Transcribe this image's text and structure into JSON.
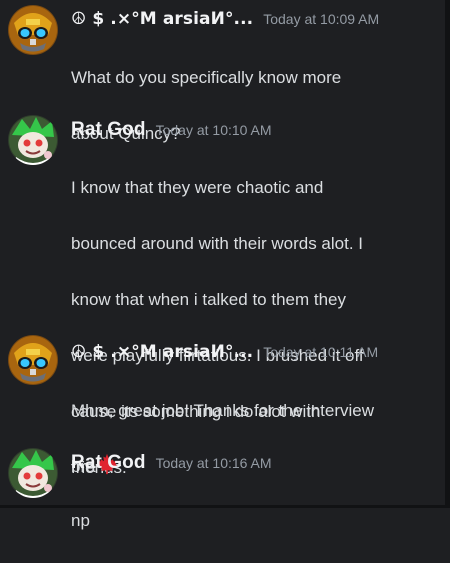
{
  "messages": [
    {
      "author": "☮ $ .×°Μ arsiaИ°...",
      "timestamp": "Today at 10:09 AM",
      "lines": [
        "What do you specifically know more",
        "about Quincy?"
      ]
    },
    {
      "author": "Rat God",
      "timestamp": "Today at 10:10 AM",
      "lines": [
        "I know that they were chaotic and",
        "bounced around with their words alot. I",
        "know that when i talked to them they",
        "were playfully flirtatious. I brushed it off",
        "cause its something i do alot with",
        "friends."
      ]
    },
    {
      "author": "☮ $ .×°Μ arsiaИ°...",
      "timestamp": "Today at 10:11 AM",
      "lines": [
        "Mhm, great job! Thanks for the interview",
        "bra"
      ],
      "emoji": "maple-leaf-icon"
    },
    {
      "author": "Rat God",
      "timestamp": "Today at 10:16 AM",
      "lines": [
        "np"
      ]
    }
  ],
  "colors": {
    "background": "#1e1f22",
    "name": "#f2f3f5",
    "timestamp": "#949ba4",
    "text": "#dbdee1",
    "maple_leaf": "#e0242f"
  }
}
